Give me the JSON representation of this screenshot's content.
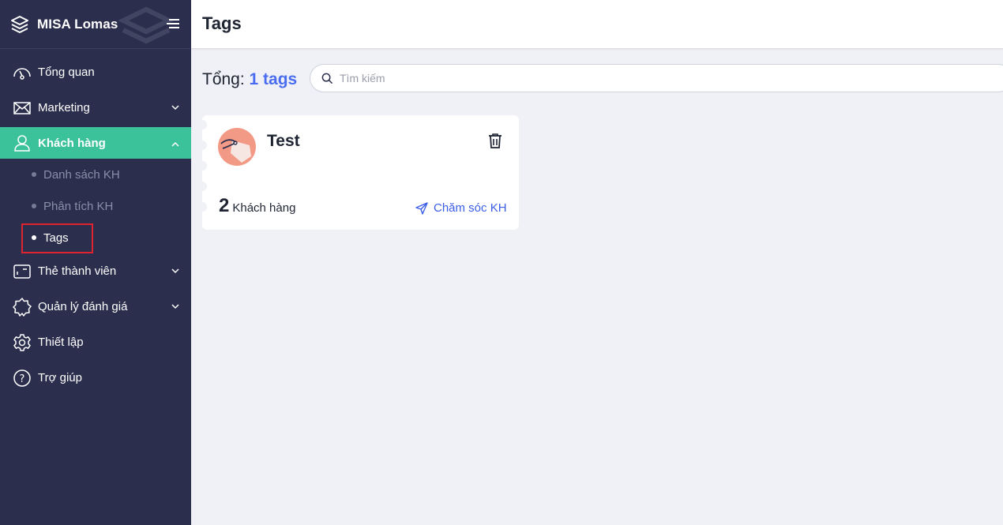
{
  "brand": {
    "name": "MISA Lomas"
  },
  "sidebar": {
    "items": [
      {
        "label": "Tổng quan",
        "icon": "dashboard-gauge-icon"
      },
      {
        "label": "Marketing",
        "icon": "mail-icon",
        "chevron": "down"
      },
      {
        "label": "Khách hàng",
        "icon": "user-icon",
        "chevron": "up",
        "active": true,
        "children": [
          {
            "label": "Danh sách KH"
          },
          {
            "label": "Phân tích KH"
          },
          {
            "label": "Tags",
            "current": true
          }
        ]
      },
      {
        "label": "Thẻ thành viên",
        "icon": "card-icon",
        "chevron": "down"
      },
      {
        "label": "Quản lý đánh giá",
        "icon": "badge-icon",
        "chevron": "down"
      },
      {
        "label": "Thiết lập",
        "icon": "gear-icon"
      },
      {
        "label": "Trợ giúp",
        "icon": "help-icon"
      }
    ]
  },
  "header": {
    "title": "Tags"
  },
  "summary": {
    "prefix": "Tổng:",
    "count_text": "1 tags"
  },
  "search": {
    "placeholder": "Tìm kiếm"
  },
  "tags": [
    {
      "name": "Test",
      "customer_count": "2",
      "customer_label": "Khách hàng",
      "action_label": "Chăm sóc KH"
    }
  ],
  "colors": {
    "sidebar_bg": "#2b2f4d",
    "active_item": "#3cc29a",
    "accent_blue": "#4a6cf0",
    "highlight_border": "#e0232f",
    "avatar_bg": "#f39a86"
  }
}
